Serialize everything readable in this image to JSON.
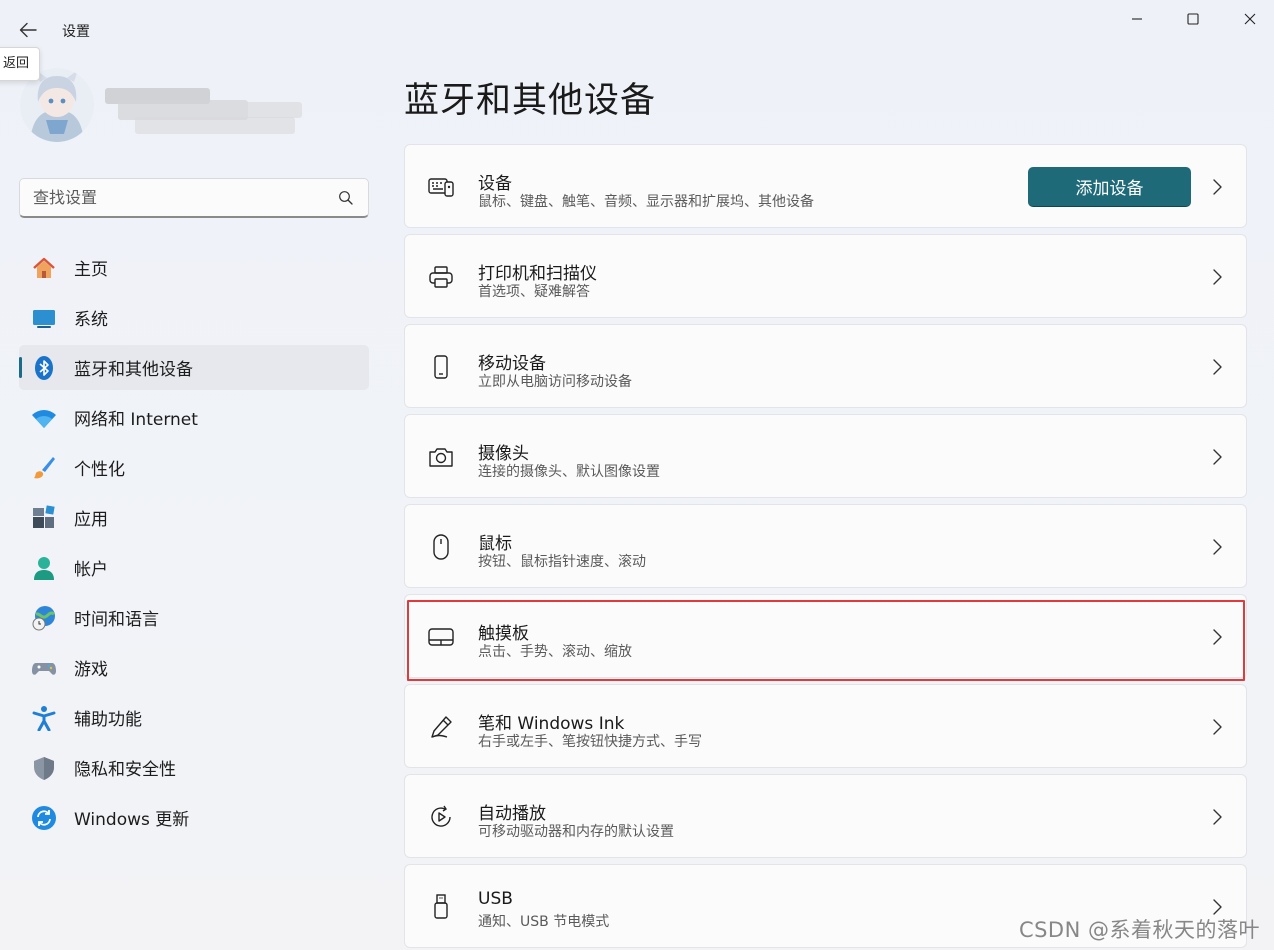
{
  "window": {
    "app_title": "设置",
    "back_tooltip": "返回"
  },
  "sidebar": {
    "search_placeholder": "查找设置",
    "nav": [
      {
        "label": "主页",
        "icon": "home-icon",
        "name": "sidebar-item-home",
        "active": false
      },
      {
        "label": "系统",
        "icon": "system-icon",
        "name": "sidebar-item-system",
        "active": false
      },
      {
        "label": "蓝牙和其他设备",
        "icon": "bluetooth-icon",
        "name": "sidebar-item-bluetooth",
        "active": true
      },
      {
        "label": "网络和 Internet",
        "icon": "wifi-icon",
        "name": "sidebar-item-network",
        "active": false
      },
      {
        "label": "个性化",
        "icon": "brush-icon",
        "name": "sidebar-item-personalization",
        "active": false
      },
      {
        "label": "应用",
        "icon": "apps-icon",
        "name": "sidebar-item-apps",
        "active": false
      },
      {
        "label": "帐户",
        "icon": "account-icon",
        "name": "sidebar-item-accounts",
        "active": false
      },
      {
        "label": "时间和语言",
        "icon": "globe-clock-icon",
        "name": "sidebar-item-time-language",
        "active": false
      },
      {
        "label": "游戏",
        "icon": "gamepad-icon",
        "name": "sidebar-item-gaming",
        "active": false
      },
      {
        "label": "辅助功能",
        "icon": "accessibility-icon",
        "name": "sidebar-item-accessibility",
        "active": false
      },
      {
        "label": "隐私和安全性",
        "icon": "shield-icon",
        "name": "sidebar-item-privacy",
        "active": false
      },
      {
        "label": "Windows 更新",
        "icon": "update-icon",
        "name": "sidebar-item-windows-update",
        "active": false
      }
    ]
  },
  "main": {
    "title": "蓝牙和其他设备",
    "add_device_label": "添加设备",
    "cards": [
      {
        "title": "设备",
        "subtitle": "鼠标、键盘、触笔、音频、显示器和扩展坞、其他设备",
        "icon": "devices-icon",
        "name": "card-devices",
        "has_button": true
      },
      {
        "title": "打印机和扫描仪",
        "subtitle": "首选项、疑难解答",
        "icon": "printer-icon",
        "name": "card-printers",
        "has_button": false
      },
      {
        "title": "移动设备",
        "subtitle": "立即从电脑访问移动设备",
        "icon": "phone-icon",
        "name": "card-mobile",
        "has_button": false
      },
      {
        "title": "摄像头",
        "subtitle": "连接的摄像头、默认图像设置",
        "icon": "camera-icon",
        "name": "card-camera",
        "has_button": false
      },
      {
        "title": "鼠标",
        "subtitle": "按钮、鼠标指针速度、滚动",
        "icon": "mouse-icon",
        "name": "card-mouse",
        "has_button": false
      },
      {
        "title": "触摸板",
        "subtitle": "点击、手势、滚动、缩放",
        "icon": "touchpad-icon",
        "name": "card-touchpad",
        "has_button": false
      },
      {
        "title": "笔和 Windows Ink",
        "subtitle": "右手或左手、笔按钮快捷方式、手写",
        "icon": "pen-icon",
        "name": "card-pen",
        "has_button": false
      },
      {
        "title": "自动播放",
        "subtitle": "可移动驱动器和内存的默认设置",
        "icon": "autoplay-icon",
        "name": "card-autoplay",
        "has_button": false
      },
      {
        "title": "USB",
        "subtitle": "通知、USB 节电模式",
        "icon": "usb-icon",
        "name": "card-usb",
        "has_button": false
      }
    ]
  },
  "watermark": "CSDN @系着秋天的落叶",
  "colors": {
    "accent": "#1e6a79",
    "highlight": "#e0393e",
    "nav_indicator": "#1a6a8a"
  }
}
